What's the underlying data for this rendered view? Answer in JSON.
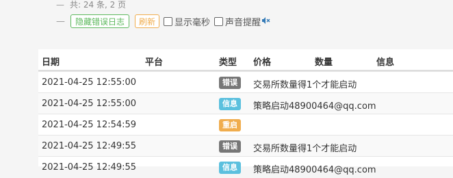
{
  "summary": {
    "dash": "—",
    "text": "共: 24 条, 2 页"
  },
  "controls": {
    "dash": "—",
    "hide_errors_label": "隐藏错误日志",
    "refresh_label": "刷新",
    "show_ms_label": "显示毫秒",
    "sound_alert_label": "声音提醒"
  },
  "table": {
    "headers": {
      "date": "日期",
      "platform": "平台",
      "type": "类型",
      "price": "价格",
      "amount": "数量",
      "info": "信息"
    },
    "rows": [
      {
        "date": "2021-04-25 12:55:00",
        "type": "错误",
        "message": "交易所数量得1个才能启动"
      },
      {
        "date": "2021-04-25 12:55:00",
        "type": "信息",
        "message": "策略启动48900464@qq.com"
      },
      {
        "date": "2021-04-25 12:54:59",
        "type": "重启",
        "message": ""
      },
      {
        "date": "2021-04-25 12:49:55",
        "type": "错误",
        "message": "交易所数量得1个才能启动"
      },
      {
        "date": "2021-04-25 12:49:55",
        "type": "信息",
        "message": "策略启动48900464@qq.com"
      }
    ]
  },
  "colors": {
    "error_badge": "#777777",
    "info_badge": "#5bc0de",
    "restart_badge": "#f0ad4e",
    "hide_button": "#5cb85c",
    "refresh_button": "#f0ad4e"
  },
  "icons": {
    "sound": "speaker-muted-icon"
  }
}
